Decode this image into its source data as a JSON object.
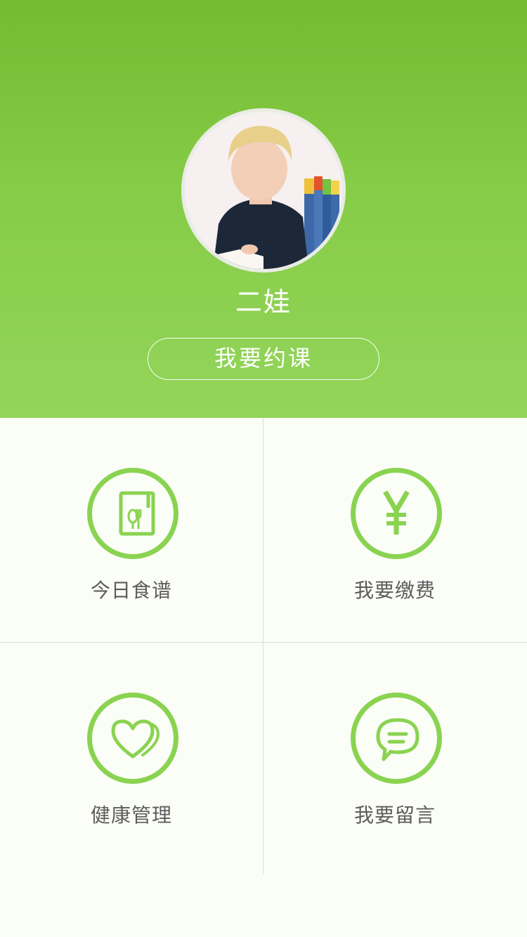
{
  "profile": {
    "name": "二娃",
    "book_button_label": "我要约课",
    "avatar_alt": "avatar"
  },
  "menu": {
    "items": [
      {
        "label": "今日食谱",
        "icon": "recipe-icon"
      },
      {
        "label": "我要缴费",
        "icon": "yuan-icon"
      },
      {
        "label": "健康管理",
        "icon": "heart-icon"
      },
      {
        "label": "我要留言",
        "icon": "message-icon"
      }
    ]
  },
  "colors": {
    "accent": "#8ad351",
    "header_top": "#73bb31",
    "header_bottom": "#93d55b",
    "label_text": "#5c5c5c",
    "background": "#fbfdf7"
  }
}
